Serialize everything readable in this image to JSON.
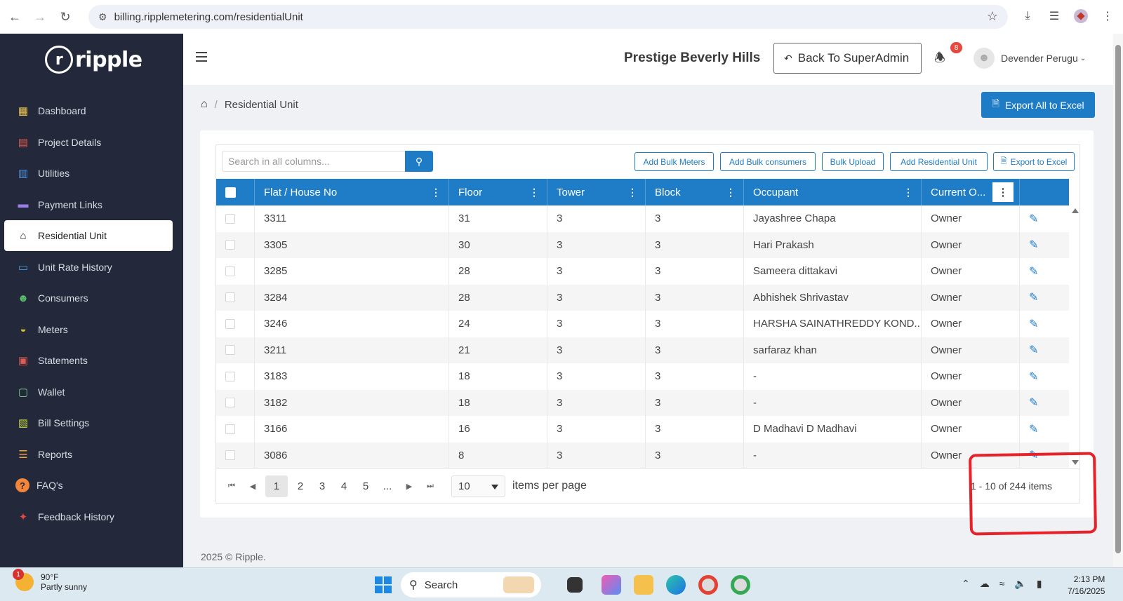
{
  "browser": {
    "url": "billing.ripplemetering.com/residentialUnit"
  },
  "sidebar": {
    "logo_text": "ripple",
    "items": [
      {
        "label": "Dashboard",
        "icon": "dashboard-icon",
        "color": "#f2c94c"
      },
      {
        "label": "Project Details",
        "icon": "project-details-icon",
        "color": "#e05a4f"
      },
      {
        "label": "Utilities",
        "icon": "utilities-icon",
        "color": "#4a8fdc"
      },
      {
        "label": "Payment Links",
        "icon": "payment-links-icon",
        "color": "#9b7fe6"
      },
      {
        "label": "Residential Unit",
        "icon": "house-icon",
        "color": "#222222",
        "active": true
      },
      {
        "label": "Unit Rate History",
        "icon": "money-icon",
        "color": "#3ea0e6"
      },
      {
        "label": "Consumers",
        "icon": "users-icon",
        "color": "#5bbf6a"
      },
      {
        "label": "Meters",
        "icon": "gauge-icon",
        "color": "#d4c13c"
      },
      {
        "label": "Statements",
        "icon": "statements-icon",
        "color": "#e05a4f"
      },
      {
        "label": "Wallet",
        "icon": "wallet-icon",
        "color": "#6fcf97"
      },
      {
        "label": "Bill Settings",
        "icon": "bill-settings-icon",
        "color": "#c6d43c"
      },
      {
        "label": "Reports",
        "icon": "reports-icon",
        "color": "#f2a13c"
      },
      {
        "label": "FAQ's",
        "icon": "question-icon",
        "color": "#f2873c"
      },
      {
        "label": "Feedback History",
        "icon": "handshake-icon",
        "color": "#e8473d"
      }
    ]
  },
  "header": {
    "site_name": "Prestige Beverly Hills",
    "back_button": "Back To SuperAdmin",
    "notification_count": "8",
    "user_name": "Devender Perugu"
  },
  "breadcrumb": {
    "current": "Residential Unit"
  },
  "export_all_label": "Export All to Excel",
  "toolbar": {
    "search_placeholder": "Search in all columns...",
    "buttons": [
      "Add Bulk Meters",
      "Add Bulk consumers",
      "Bulk Upload",
      "Add Residential Unit",
      "Export to Excel"
    ]
  },
  "table": {
    "columns": [
      "Flat / House No",
      "Floor",
      "Tower",
      "Block",
      "Occupant",
      "Current O..."
    ],
    "rows": [
      [
        "3311",
        "31",
        "3",
        "3",
        "Jayashree Chapa",
        "Owner"
      ],
      [
        "3305",
        "30",
        "3",
        "3",
        "Hari Prakash",
        "Owner"
      ],
      [
        "3285",
        "28",
        "3",
        "3",
        "Sameera dittakavi",
        "Owner"
      ],
      [
        "3284",
        "28",
        "3",
        "3",
        "Abhishek Shrivastav",
        "Owner"
      ],
      [
        "3246",
        "24",
        "3",
        "3",
        "HARSHA SAINATHREDDY KOND...",
        "Owner"
      ],
      [
        "3211",
        "21",
        "3",
        "3",
        "sarfaraz khan",
        "Owner"
      ],
      [
        "3183",
        "18",
        "3",
        "3",
        "-",
        "Owner"
      ],
      [
        "3182",
        "18",
        "3",
        "3",
        "-",
        "Owner"
      ],
      [
        "3166",
        "16",
        "3",
        "3",
        "D Madhavi D Madhavi",
        "Owner"
      ],
      [
        "3086",
        "8",
        "3",
        "3",
        "-",
        "Owner"
      ]
    ]
  },
  "pager": {
    "pages": [
      "1",
      "2",
      "3",
      "4",
      "5",
      "..."
    ],
    "current_page": "1",
    "per_page": "10",
    "per_page_label": "items per page",
    "info": "1 - 10 of 244 items"
  },
  "footer": "2025 © Ripple.",
  "taskbar": {
    "weather_temp": "90°F",
    "weather_desc": "Partly sunny",
    "weather_badge": "1",
    "search_label": "Search",
    "time": "2:13 PM",
    "date": "7/16/2025"
  },
  "colors": {
    "sidebar_bg": "#23293a",
    "accent": "#1e7cc7",
    "annotation": "#e8202a"
  }
}
